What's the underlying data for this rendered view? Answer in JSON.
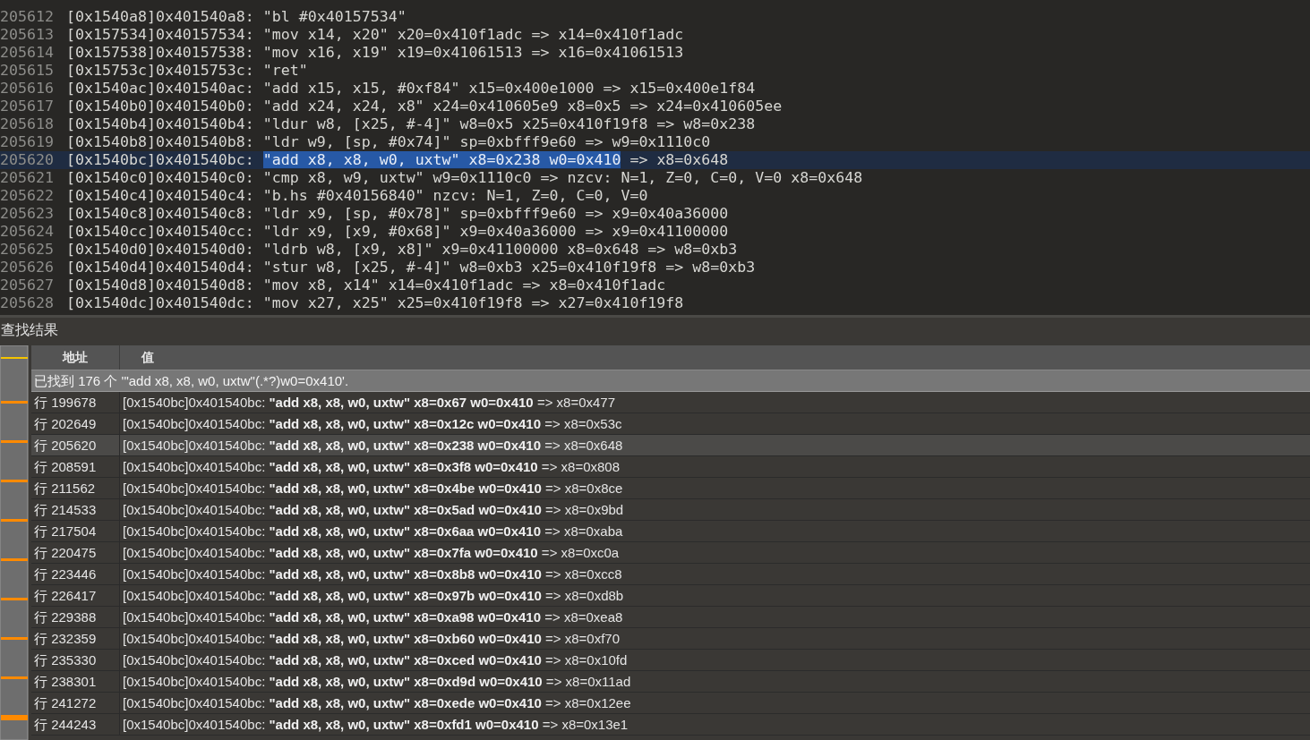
{
  "editor": {
    "lines": [
      {
        "number": "205612",
        "current": false,
        "segments": [
          {
            "text": "[0x1540a8]0x401540a8: \"bl #0x40157534\"",
            "selected": false
          }
        ]
      },
      {
        "number": "205613",
        "current": false,
        "segments": [
          {
            "text": "[0x157534]0x40157534: \"mov x14, x20\" x20=0x410f1adc => x14=0x410f1adc",
            "selected": false
          }
        ]
      },
      {
        "number": "205614",
        "current": false,
        "segments": [
          {
            "text": "[0x157538]0x40157538: \"mov x16, x19\" x19=0x41061513 => x16=0x41061513",
            "selected": false
          }
        ]
      },
      {
        "number": "205615",
        "current": false,
        "segments": [
          {
            "text": "[0x15753c]0x4015753c: \"ret\"",
            "selected": false
          }
        ]
      },
      {
        "number": "205616",
        "current": false,
        "segments": [
          {
            "text": "[0x1540ac]0x401540ac: \"add x15, x15, #0xf84\" x15=0x400e1000 => x15=0x400e1f84",
            "selected": false
          }
        ]
      },
      {
        "number": "205617",
        "current": false,
        "segments": [
          {
            "text": "[0x1540b0]0x401540b0: \"add x24, x24, x8\" x24=0x410605e9 x8=0x5 => x24=0x410605ee",
            "selected": false
          }
        ]
      },
      {
        "number": "205618",
        "current": false,
        "segments": [
          {
            "text": "[0x1540b4]0x401540b4: \"ldur w8, [x25, #-4]\" w8=0x5 x25=0x410f19f8 => w8=0x238",
            "selected": false
          }
        ]
      },
      {
        "number": "205619",
        "current": false,
        "segments": [
          {
            "text": "[0x1540b8]0x401540b8: \"ldr w9, [sp, #0x74]\" sp=0xbfff9e60 => w9=0x1110c0",
            "selected": false
          }
        ]
      },
      {
        "number": "205620",
        "current": true,
        "segments": [
          {
            "text": "[0x1540bc]0x401540bc: ",
            "selected": false
          },
          {
            "text": "\"add x8, x8, w0, uxtw\" x8=0x238 w0=0x410",
            "selected": true
          },
          {
            "text": " => x8=0x648",
            "selected": false
          }
        ]
      },
      {
        "number": "205621",
        "current": false,
        "segments": [
          {
            "text": "[0x1540c0]0x401540c0: \"cmp x8, w9, uxtw\" w9=0x1110c0 => nzcv: N=1, Z=0, C=0, V=0 x8=0x648",
            "selected": false
          }
        ]
      },
      {
        "number": "205622",
        "current": false,
        "segments": [
          {
            "text": "[0x1540c4]0x401540c4: \"b.hs #0x40156840\" nzcv: N=1, Z=0, C=0, V=0",
            "selected": false
          }
        ]
      },
      {
        "number": "205623",
        "current": false,
        "segments": [
          {
            "text": "[0x1540c8]0x401540c8: \"ldr x9, [sp, #0x78]\" sp=0xbfff9e60 => x9=0x40a36000",
            "selected": false
          }
        ]
      },
      {
        "number": "205624",
        "current": false,
        "segments": [
          {
            "text": "[0x1540cc]0x401540cc: \"ldr x9, [x9, #0x68]\" x9=0x40a36000 => x9=0x41100000",
            "selected": false
          }
        ]
      },
      {
        "number": "205625",
        "current": false,
        "segments": [
          {
            "text": "[0x1540d0]0x401540d0: \"ldrb w8, [x9, x8]\" x9=0x41100000 x8=0x648 => w8=0xb3",
            "selected": false
          }
        ]
      },
      {
        "number": "205626",
        "current": false,
        "segments": [
          {
            "text": "[0x1540d4]0x401540d4: \"stur w8, [x25, #-4]\" w8=0xb3 x25=0x410f19f8 => w8=0xb3",
            "selected": false
          }
        ]
      },
      {
        "number": "205627",
        "current": false,
        "segments": [
          {
            "text": "[0x1540d8]0x401540d8: \"mov x8, x14\" x14=0x410f1adc => x8=0x410f1adc",
            "selected": false
          }
        ]
      },
      {
        "number": "205628",
        "current": false,
        "segments": [
          {
            "text": "[0x1540dc]0x401540dc: \"mov x27, x25\" x25=0x410f19f8 => x27=0x410f19f8",
            "selected": false
          }
        ]
      }
    ]
  },
  "results": {
    "title": "查找结果",
    "columns": [
      "地址",
      "值"
    ],
    "summary": "已找到 176 个 '\"add x8, x8, w0, uxtw\"(.*?)w0=0x410'.",
    "rows": [
      {
        "address": "行 199678",
        "value": "[0x1540bc]0x401540bc: **\"add x8, x8, w0, uxtw\" x8=0x67 w0=0x410** => x8=0x477",
        "selected": false
      },
      {
        "address": "行 202649",
        "value": "[0x1540bc]0x401540bc: **\"add x8, x8, w0, uxtw\" x8=0x12c w0=0x410** => x8=0x53c",
        "selected": false
      },
      {
        "address": "行 205620",
        "value": "[0x1540bc]0x401540bc: **\"add x8, x8, w0, uxtw\" x8=0x238 w0=0x410** => x8=0x648",
        "selected": true
      },
      {
        "address": "行 208591",
        "value": "[0x1540bc]0x401540bc: **\"add x8, x8, w0, uxtw\" x8=0x3f8 w0=0x410** => x8=0x808",
        "selected": false
      },
      {
        "address": "行 211562",
        "value": "[0x1540bc]0x401540bc: **\"add x8, x8, w0, uxtw\" x8=0x4be w0=0x410** => x8=0x8ce",
        "selected": false
      },
      {
        "address": "行 214533",
        "value": "[0x1540bc]0x401540bc: **\"add x8, x8, w0, uxtw\" x8=0x5ad w0=0x410** => x8=0x9bd",
        "selected": false
      },
      {
        "address": "行 217504",
        "value": "[0x1540bc]0x401540bc: **\"add x8, x8, w0, uxtw\" x8=0x6aa w0=0x410** => x8=0xaba",
        "selected": false
      },
      {
        "address": "行 220475",
        "value": "[0x1540bc]0x401540bc: **\"add x8, x8, w0, uxtw\" x8=0x7fa w0=0x410** => x8=0xc0a",
        "selected": false
      },
      {
        "address": "行 223446",
        "value": "[0x1540bc]0x401540bc: **\"add x8, x8, w0, uxtw\" x8=0x8b8 w0=0x410** => x8=0xcc8",
        "selected": false
      },
      {
        "address": "行 226417",
        "value": "[0x1540bc]0x401540bc: **\"add x8, x8, w0, uxtw\" x8=0x97b w0=0x410** => x8=0xd8b",
        "selected": false
      },
      {
        "address": "行 229388",
        "value": "[0x1540bc]0x401540bc: **\"add x8, x8, w0, uxtw\" x8=0xa98 w0=0x410** => x8=0xea8",
        "selected": false
      },
      {
        "address": "行 232359",
        "value": "[0x1540bc]0x401540bc: **\"add x8, x8, w0, uxtw\" x8=0xb60 w0=0x410** => x8=0xf70",
        "selected": false
      },
      {
        "address": "行 235330",
        "value": "[0x1540bc]0x401540bc: **\"add x8, x8, w0, uxtw\" x8=0xced w0=0x410** => x8=0x10fd",
        "selected": false
      },
      {
        "address": "行 238301",
        "value": "[0x1540bc]0x401540bc: **\"add x8, x8, w0, uxtw\" x8=0xd9d w0=0x410** => x8=0x11ad",
        "selected": false
      },
      {
        "address": "行 241272",
        "value": "[0x1540bc]0x401540bc: **\"add x8, x8, w0, uxtw\" x8=0xede w0=0x410** => x8=0x12ee",
        "selected": false
      },
      {
        "address": "行 244243",
        "value": "[0x1540bc]0x401540bc: **\"add x8, x8, w0, uxtw\" x8=0xfd1 w0=0x410** => x8=0x13e1",
        "selected": false
      }
    ]
  }
}
